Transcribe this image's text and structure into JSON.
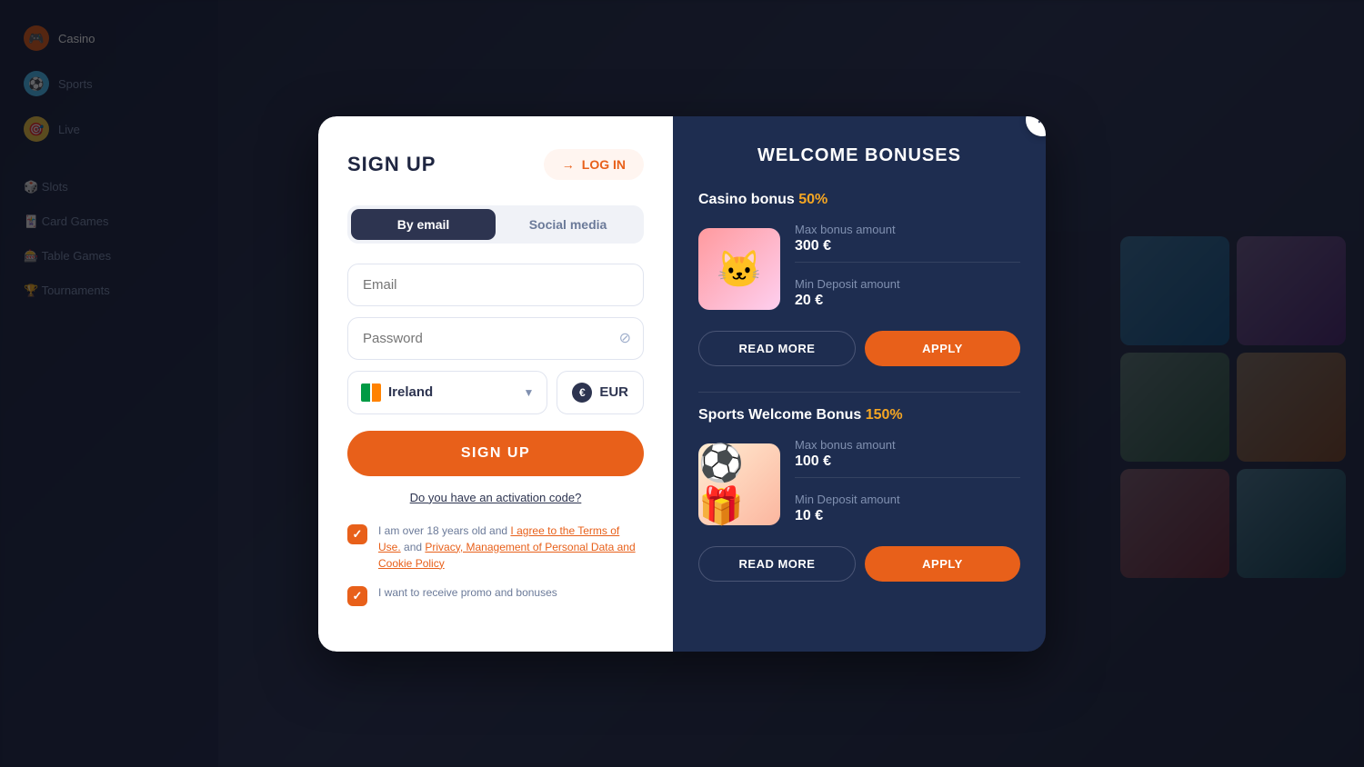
{
  "modal": {
    "close_label": "×",
    "signup": {
      "title": "SIGN UP",
      "login_button": "LOG IN",
      "tabs": [
        {
          "label": "By email",
          "active": true
        },
        {
          "label": "Social media",
          "active": false
        }
      ],
      "email_placeholder": "Email",
      "password_placeholder": "Password",
      "country": {
        "name": "Ireland",
        "currency": "EUR"
      },
      "submit_button": "SIGN UP",
      "activation_code_link": "Do you have an activation code?",
      "checkboxes": [
        {
          "checked": true,
          "label_plain": "I am over 18 years old and ",
          "label_link1": "I agree to the Terms of Use.",
          "label_middle": " and ",
          "label_link2": "Privacy, Management of Personal Data and Cookie Policy"
        },
        {
          "checked": true,
          "label": "I want to receive promo and bonuses"
        }
      ]
    },
    "bonuses": {
      "title": "WELCOME BONUSES",
      "cards": [
        {
          "title_plain": "Casino bonus ",
          "title_percent": "50%",
          "max_bonus_label": "Max bonus amount",
          "max_bonus_value": "300 €",
          "min_deposit_label": "Min Deposit amount",
          "min_deposit_value": "20 €",
          "read_more": "READ MORE",
          "apply": "APPLY"
        },
        {
          "title_plain": "Sports Welcome Bonus ",
          "title_percent": "150%",
          "max_bonus_label": "Max bonus amount",
          "max_bonus_value": "100 €",
          "min_deposit_label": "Min Deposit amount",
          "min_deposit_value": "10 €",
          "read_more": "READ MORE",
          "apply": "APPLY"
        }
      ]
    }
  }
}
